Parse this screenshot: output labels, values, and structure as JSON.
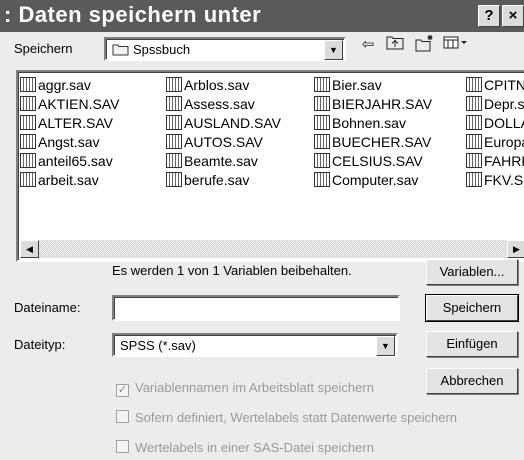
{
  "window": {
    "title": ": Daten speichern unter",
    "help_label": "?",
    "close_label": "×"
  },
  "toolbar": {
    "save_in_label": "Speichern",
    "folder": "Spssbuch",
    "dropdown_glyph": "▼",
    "up_glyph": "⇦",
    "icons": [
      "back-icon",
      "up-one-level-icon",
      "new-folder-icon",
      "view-menu-icon"
    ]
  },
  "files": {
    "columns": [
      [
        "aggr.sav",
        "AKTIEN.SAV",
        "ALTER.SAV",
        "Angst.sav",
        "anteil65.sav",
        "arbeit.sav"
      ],
      [
        "Arblos.sav",
        "Assess.sav",
        "AUSLAND.SAV",
        "AUTOS.SAV",
        "Beamte.sav",
        "berufe.sav"
      ],
      [
        "Bier.sav",
        "BIERJAHR.SAV",
        "Bohnen.sav",
        "BUECHER.SAV",
        "CELSIUS.SAV",
        "Computer.sav"
      ],
      [
        "CPITNA",
        "Depr.s",
        "DOLLA",
        "Europa",
        "FAHRR",
        "FKV.S."
      ]
    ]
  },
  "scroll": {
    "left_glyph": "◀",
    "right_glyph": "▶"
  },
  "info": "Es werden 1 von 1 Variablen beibehalten.",
  "filename": {
    "label": "Dateiname:",
    "value": ""
  },
  "filetype": {
    "label": "Dateityp:",
    "value": "SPSS (*.sav)"
  },
  "buttons": {
    "variables": "Variablen...",
    "save": "Speichern",
    "paste": "Einfügen",
    "cancel": "Abbrechen"
  },
  "options": [
    {
      "label": "Variablennamen im Arbeitsblatt speichern",
      "checked": true
    },
    {
      "label": "Sofern definiert, Wertelabels statt Datenwerte speichern",
      "checked": false
    },
    {
      "label": "Wertelabels in einer SAS-Datei speichern",
      "checked": false
    }
  ]
}
